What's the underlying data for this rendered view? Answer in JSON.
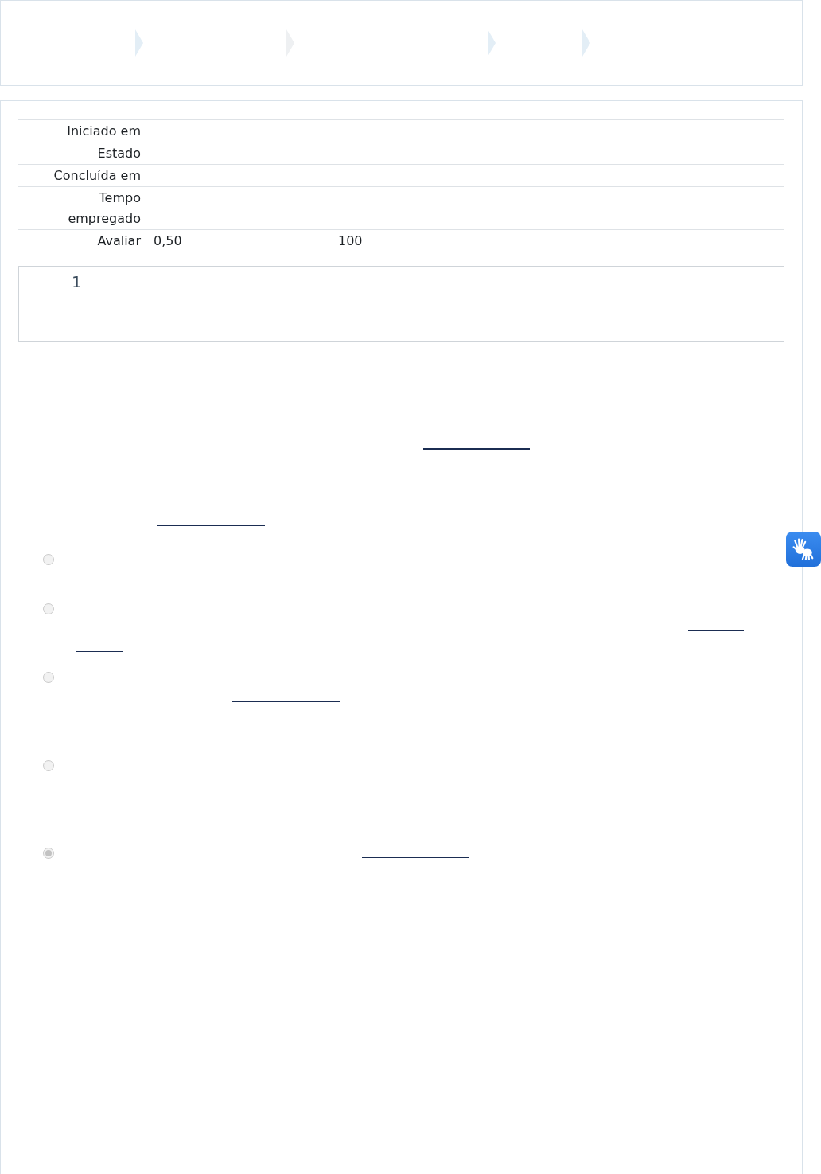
{
  "info_table": {
    "rows": [
      {
        "label": "Iniciado em"
      },
      {
        "label": "Estado"
      },
      {
        "label": "Concluída em"
      },
      {
        "label": "Tempo empregado"
      },
      {
        "label": "Avaliar",
        "values": [
          "0,50",
          "100"
        ]
      }
    ]
  },
  "question": {
    "number": "1"
  },
  "options": [
    {
      "checked": false
    },
    {
      "checked": false
    },
    {
      "checked": false
    },
    {
      "checked": false
    },
    {
      "checked": true
    }
  ]
}
